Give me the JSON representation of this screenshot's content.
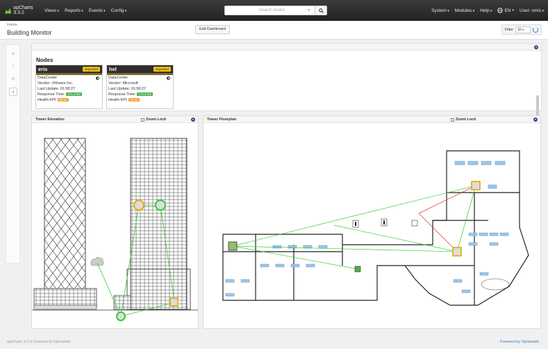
{
  "navbar": {
    "brand": "opCharts 3.3.2",
    "menus": [
      "Views",
      "Reports",
      "Events",
      "Config"
    ],
    "search_placeholder": "Search Nodes",
    "right_menus": [
      "System",
      "Modules",
      "Help"
    ],
    "language": "EN",
    "user": "User: nmis"
  },
  "header": {
    "breadcrumb": "Home",
    "title": "Building Monitor",
    "edit_button": "Edit Dashboard",
    "filter_label": "Filter",
    "filter_value": "1h"
  },
  "nodes_panel": {
    "title": "Nodes",
    "nodes": [
      {
        "name": "eris",
        "status": "degraded",
        "group": "DataCenter",
        "vendor": "Vendor: VMware Inc.",
        "update": "Last Update: 01:58:27",
        "resp_label": "Response Time:",
        "resp_value": "171.3 ms",
        "kpi_label": "Health KPI:",
        "kpi_value": "89.84"
      },
      {
        "name": "hel",
        "status": "degraded",
        "group": "DataCenter",
        "vendor": "Vendor: Microsoft",
        "update": "Last Update: 01:58:27",
        "resp_label": "Response Time:",
        "resp_value": "171.3 ms",
        "kpi_label": "Health KPI:",
        "kpi_value": "80.41"
      }
    ]
  },
  "elevation_panel": {
    "title": "Tower Elevation",
    "zoom_lock": "Zoom Lock"
  },
  "floorplan_panel": {
    "title": "Tower Floorplan",
    "zoom_lock": "Zoom Lock"
  },
  "footer": {
    "left": "opCharts 3.2 is licensed to Opmantek",
    "right": "Powered by Opmantek"
  },
  "colors": {
    "accent": "#3a7cc5",
    "degraded": "#f1c40f",
    "ok": "#4caf50",
    "link_up": "#33cc33",
    "link_down": "#e03030"
  }
}
